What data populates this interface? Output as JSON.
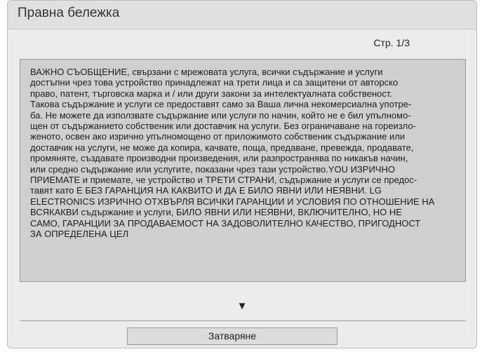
{
  "dialog": {
    "title": "Правна бележка",
    "page_indicator": "Стр. 1/3",
    "content": "ВАЖНО СЪОБЩЕНИЕ, свързани с мрежовата услуга, всички съдържание и услуги\nдостъпни чрез това устройство принадлежат на трети лица и са защитени от авторско\nправо, патент, търговска марка и / или други закони за интелектуалната собственост.\nТакова съдържание и услуги се предоставят само за Ваша лична некомерсиална употре-\nба. Не можете да използвате съдържание или услуги по начин, който не е бил упълномо-\nщен от съдържанието собственик или доставчик на услуги. Без ограничаване на гореизло-\nженото, освен ако изрично упълномощено от приложимото собственик съдържание или\nдоставчик на услуги, не може да копира, качвате, поща, предаване, превежда, продавате,\nпромяняте, създавате производни произведения, или разпространява по никакъв начин,\nили средно съдържание или услугите, показани чрез тази устройство.YOU ИЗРИЧНО\nПРИЕМАТЕ и приемате, че устройство и ТРЕТИ СТРАНИ, съдържание и услуги се предос-\nтавят като Е БЕЗ ГАРАНЦИЯ НА КАКВИТО И ДА Е БИЛО ЯВНИ ИЛИ НЕЯВНИ. LG\nELECTRONICS ИЗРИЧНО ОТХВЪРЛЯ ВСИЧКИ ГАРАНЦИИ И УСЛОВИЯ ПО ОТНОШЕНИЕ НА\nВСЯКАКВИ съдържание и услуги, БИЛО ЯВНИ ИЛИ НЕЯВНИ, ВКЛЮЧИТЕЛНО, НО НЕ\nСАМО, ГАРАНЦИИ ЗА ПРОДАВАЕМОСТ НА ЗАДОВОЛИТЕЛНО КАЧЕСТВО, ПРИГОДНОСТ\nЗА ОПРЕДЕЛЕНА ЦЕЛ",
    "scroll_down_glyph": "▼",
    "close_label": "Затваряне"
  }
}
